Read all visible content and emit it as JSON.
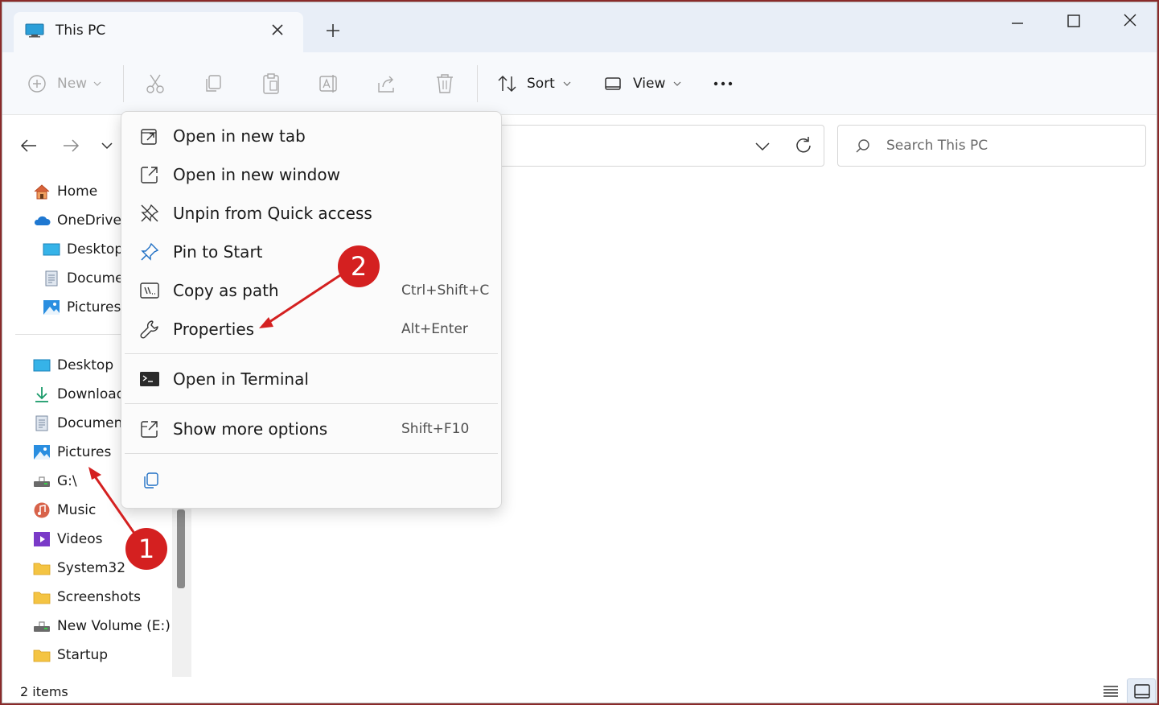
{
  "window": {
    "tab_title": "This PC"
  },
  "toolbar": {
    "new_label": "New",
    "sort_label": "Sort",
    "view_label": "View"
  },
  "search": {
    "placeholder": "Search This PC"
  },
  "sidebar": {
    "quick": [
      {
        "label": "Home",
        "icon": "home-icon"
      },
      {
        "label": "OneDrive",
        "icon": "cloud-icon"
      },
      {
        "label": "Desktop",
        "icon": "desktop-icon"
      },
      {
        "label": "Docume",
        "icon": "document-icon"
      },
      {
        "label": "Pictures",
        "icon": "pictures-icon"
      }
    ],
    "pinned": [
      {
        "label": "Desktop",
        "icon": "desktop-icon"
      },
      {
        "label": "Download",
        "icon": "download-icon"
      },
      {
        "label": "Document",
        "icon": "document-icon"
      },
      {
        "label": "Pictures",
        "icon": "pictures-icon"
      },
      {
        "label": "G:\\",
        "icon": "drive-icon"
      },
      {
        "label": "Music",
        "icon": "music-icon"
      },
      {
        "label": "Videos",
        "icon": "videos-icon"
      },
      {
        "label": "System32",
        "icon": "folder-icon"
      },
      {
        "label": "Screenshots",
        "icon": "folder-icon"
      },
      {
        "label": "New Volume (E:)",
        "icon": "drive-icon"
      },
      {
        "label": "Startup",
        "icon": "folder-icon"
      }
    ]
  },
  "context_menu": {
    "items": [
      {
        "label": "Open in new tab",
        "shortcut": "",
        "icon": "open-new-tab-icon"
      },
      {
        "label": "Open in new window",
        "shortcut": "",
        "icon": "open-new-window-icon"
      },
      {
        "label": "Unpin from Quick access",
        "shortcut": "",
        "icon": "unpin-icon"
      },
      {
        "label": "Pin to Start",
        "shortcut": "",
        "icon": "pin-icon"
      },
      {
        "label": "Copy as path",
        "shortcut": "Ctrl+Shift+C",
        "icon": "copy-path-icon"
      },
      {
        "label": "Properties",
        "shortcut": "Alt+Enter",
        "icon": "wrench-icon"
      },
      {
        "label": "Open in Terminal",
        "shortcut": "",
        "icon": "terminal-icon"
      },
      {
        "label": "Show more options",
        "shortcut": "Shift+F10",
        "icon": "more-options-icon"
      }
    ],
    "bottom_icon": "copy-icon"
  },
  "annotations": [
    {
      "number": "1",
      "color": "#d42020"
    },
    {
      "number": "2",
      "color": "#d42020"
    }
  ],
  "status": {
    "item_count": "2 items"
  }
}
